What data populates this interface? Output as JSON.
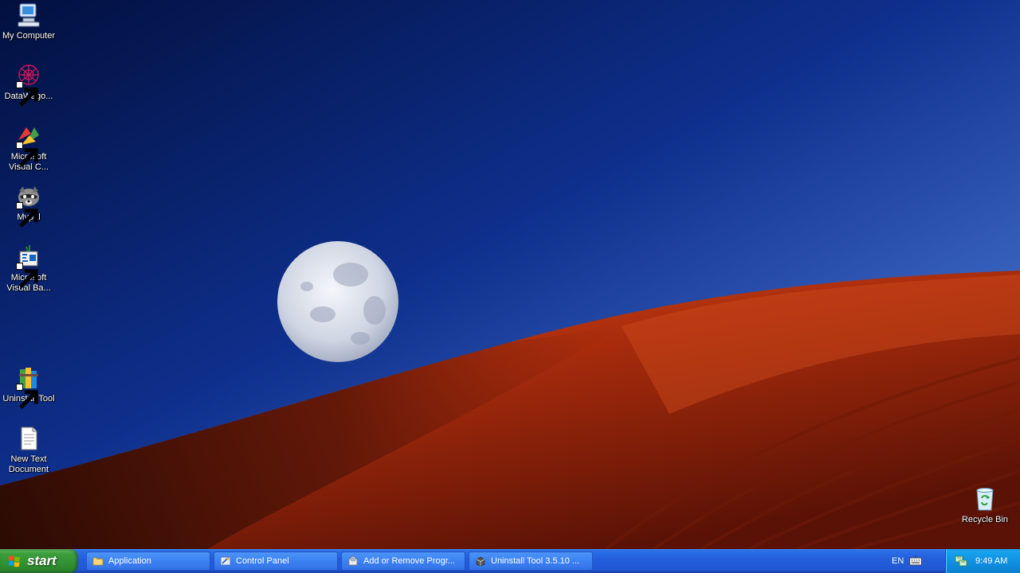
{
  "desktop": {
    "icons": [
      {
        "label": "My Computer",
        "icon": "computer-icon"
      },
      {
        "label": "DataWago...",
        "icon": "datawagon-icon"
      },
      {
        "label": "Microsoft Visual C...",
        "icon": "visual-c-icon"
      },
      {
        "label": "Mypal",
        "icon": "mypal-raccoon-icon"
      },
      {
        "label": "Microsoft Visual Ba...",
        "icon": "visual-basic-icon"
      },
      {
        "label": "Uninstall Tool",
        "icon": "uninstall-tool-icon"
      },
      {
        "label": "New Text Document",
        "icon": "text-document-icon"
      },
      {
        "label": "Recycle Bin",
        "icon": "recycle-bin-icon"
      }
    ]
  },
  "taskbar": {
    "start_label": "start",
    "buttons": [
      {
        "label": "Application",
        "icon": "folder-icon"
      },
      {
        "label": "Control Panel",
        "icon": "control-panel-icon"
      },
      {
        "label": "Add or Remove Progr...",
        "icon": "add-remove-programs-icon"
      },
      {
        "label": "Uninstall Tool 3.5.10 ...",
        "icon": "uninstall-tool-icon"
      }
    ],
    "language": "EN",
    "clock": "9:49 AM"
  },
  "colors": {
    "sky_top": "#03134e",
    "sky_bottom": "#3d6fd0",
    "dune": "#b5300e",
    "taskbar": "#245edb",
    "start_green": "#3c9e3c"
  }
}
